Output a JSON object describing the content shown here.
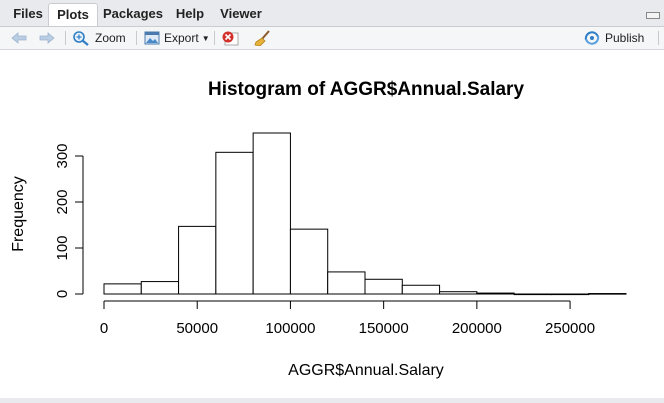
{
  "tabs": [
    {
      "label": "Files",
      "active": false
    },
    {
      "label": "Plots",
      "active": true
    },
    {
      "label": "Packages",
      "active": false
    },
    {
      "label": "Help",
      "active": false
    },
    {
      "label": "Viewer",
      "active": false
    }
  ],
  "toolbar": {
    "zoom_label": "Zoom",
    "export_label": "Export",
    "publish_label": "Publish"
  },
  "icons": {
    "back": "arrow-left-icon",
    "forward": "arrow-right-icon",
    "zoom": "zoom-icon",
    "export": "export-icon",
    "remove": "remove-plot-icon",
    "clear": "broom-icon",
    "publish": "publish-icon"
  },
  "colors": {
    "accent_blue": "#2f7fc7",
    "remove_red": "#d2302a"
  },
  "chart_data": {
    "type": "bar",
    "title": "Histogram of AGGR$Annual.Salary",
    "xlabel": "AGGR$Annual.Salary",
    "ylabel": "Frequency",
    "bin_edges": [
      0,
      20000,
      40000,
      60000,
      80000,
      100000,
      120000,
      140000,
      160000,
      180000,
      200000,
      220000,
      240000,
      260000,
      280000
    ],
    "values": [
      22,
      27,
      147,
      308,
      350,
      141,
      48,
      32,
      19,
      5,
      2,
      0,
      0,
      1
    ],
    "xlim": [
      0,
      280000
    ],
    "ylim": [
      0,
      350
    ],
    "x_ticks": [
      0,
      50000,
      100000,
      150000,
      200000,
      250000
    ],
    "x_tick_labels": [
      "0",
      "50000",
      "100000",
      "150000",
      "200000",
      "250000"
    ],
    "y_ticks": [
      0,
      100,
      200,
      300
    ],
    "y_tick_labels": [
      "0",
      "100",
      "200",
      "300"
    ],
    "grid": false
  }
}
